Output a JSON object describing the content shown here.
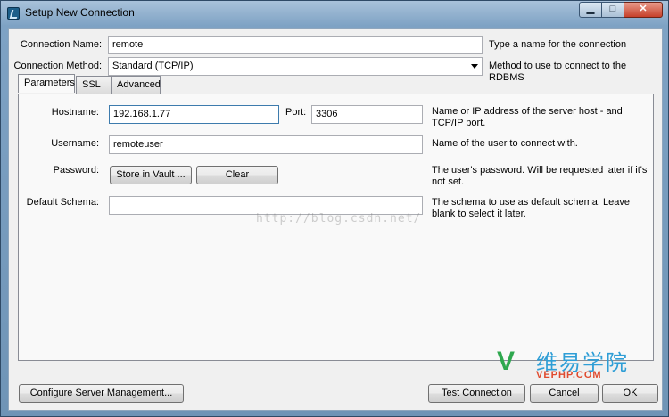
{
  "window": {
    "title": "Setup New Connection",
    "controls": {
      "minimize": "▁",
      "maximize": "□",
      "close": "✕"
    }
  },
  "form": {
    "connection_name_label": "Connection Name:",
    "connection_name_value": "remote",
    "connection_name_help": "Type a name for the connection",
    "connection_method_label": "Connection Method:",
    "connection_method_value": "Standard (TCP/IP)",
    "connection_method_help": "Method to use to connect to the RDBMS"
  },
  "tabs": [
    {
      "label": "Parameters",
      "active": true
    },
    {
      "label": "SSL",
      "active": false
    },
    {
      "label": "Advanced",
      "active": false
    }
  ],
  "parameters": {
    "hostname_label": "Hostname:",
    "hostname_value": "192.168.1.77",
    "port_label": "Port:",
    "port_value": "3306",
    "hostname_help_1": "Name or IP address of the server host - and",
    "hostname_help_2": "TCP/IP port.",
    "username_label": "Username:",
    "username_value": "remoteuser",
    "username_help": "Name of the user to connect with.",
    "password_label": "Password:",
    "store_vault_label": "Store in Vault ...",
    "clear_label": "Clear",
    "password_help_1": "The user's password. Will be requested later if it's",
    "password_help_2": "not set.",
    "schema_label": "Default Schema:",
    "schema_value": "",
    "schema_help_1": "The schema to use as default schema. Leave",
    "schema_help_2": "blank to select it later."
  },
  "watermark": "http://blog.csdn.net/",
  "footer": {
    "configure_label": "Configure Server Management...",
    "test_label": "Test Connection",
    "cancel_label": "Cancel",
    "ok_label": "OK"
  },
  "logo": {
    "mark": "V",
    "cn": "维易学院",
    "en": "VEPHP.COM"
  }
}
